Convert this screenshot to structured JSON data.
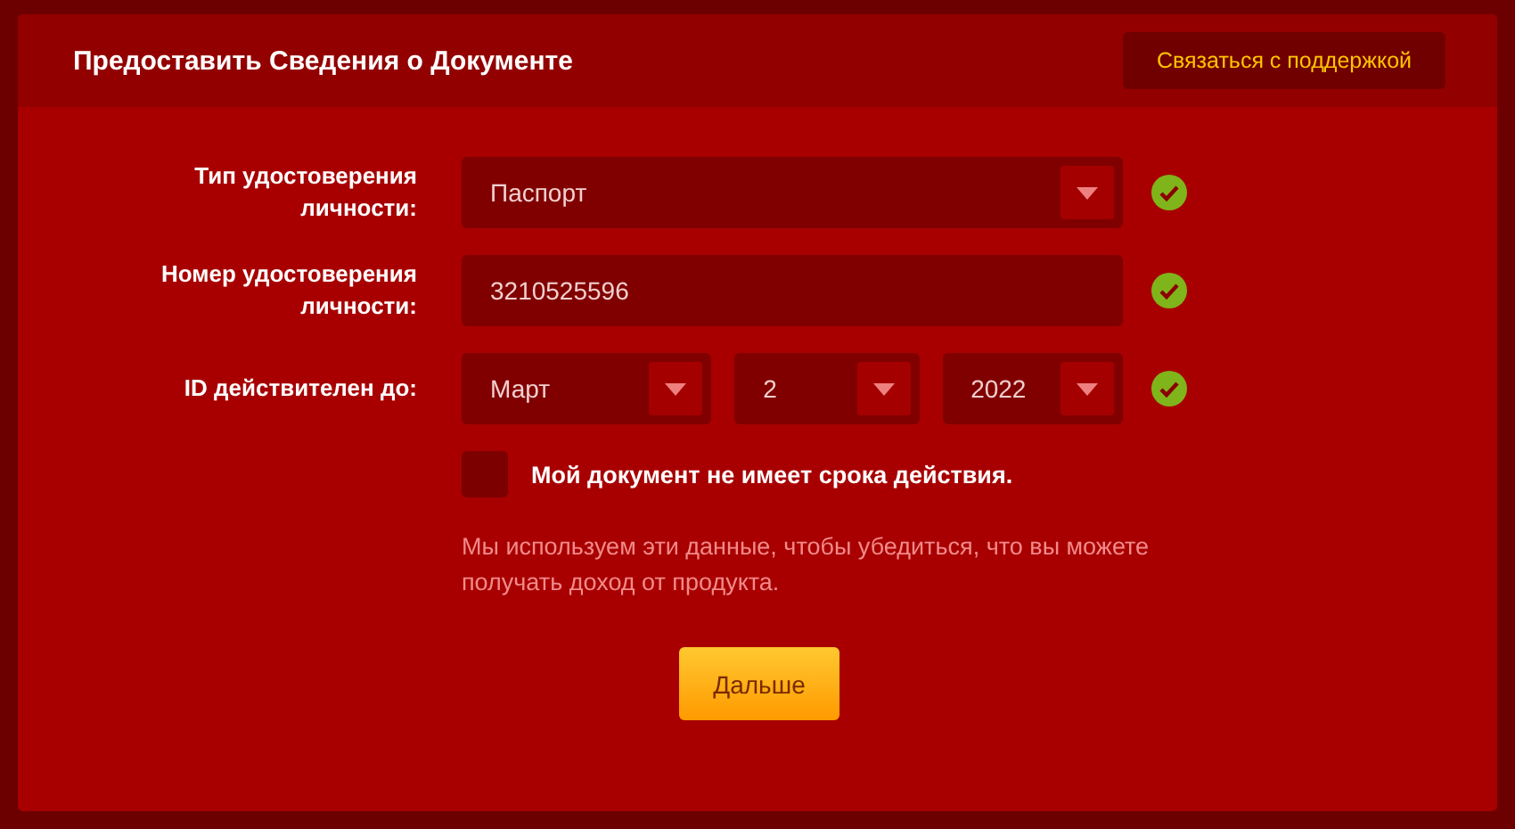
{
  "header": {
    "title": "Предоставить Сведения о Документе",
    "support_button": "Связаться с поддержкой"
  },
  "fields": [
    {
      "label": "Тип удостоверения личности:",
      "kind": "select",
      "parts": [
        "Паспорт"
      ],
      "valid": true
    },
    {
      "label": "Номер удостоверения личности:",
      "kind": "input",
      "parts": [
        "3210525596"
      ],
      "valid": true
    },
    {
      "label": "ID действителен до:",
      "kind": "date",
      "parts": [
        "Март",
        "2",
        "2022"
      ],
      "valid": true
    }
  ],
  "no_expiry": {
    "label": "Мой документ не имеет срока действия.",
    "checked": false
  },
  "note": "Мы используем эти данные, чтобы убедиться, что вы можете получать доход от продукта.",
  "next_button": "Дальше"
}
